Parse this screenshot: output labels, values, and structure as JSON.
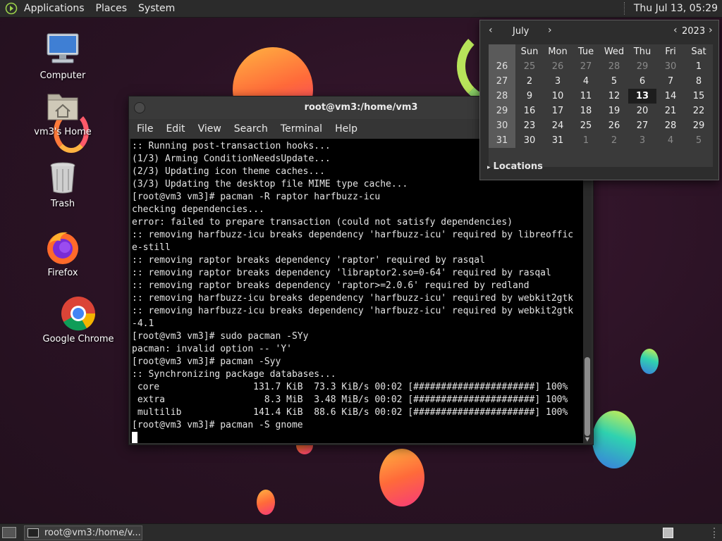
{
  "top_panel": {
    "menus": [
      "Applications",
      "Places",
      "System"
    ],
    "clock": "Thu Jul 13, 05:29"
  },
  "desktop_icons": [
    {
      "label": "Computer",
      "icon": "computer-icon"
    },
    {
      "label": "vm3's Home",
      "icon": "home-folder-icon"
    },
    {
      "label": "Trash",
      "icon": "trash-icon"
    },
    {
      "label": "Firefox",
      "icon": "firefox-icon"
    },
    {
      "label": "Google Chrome",
      "icon": "chrome-icon"
    }
  ],
  "terminal": {
    "title": "root@vm3:/home/vm3",
    "menu": [
      "File",
      "Edit",
      "View",
      "Search",
      "Terminal",
      "Help"
    ],
    "lines": [
      ":: Running post-transaction hooks...",
      "(1/3) Arming ConditionNeedsUpdate...",
      "(2/3) Updating icon theme caches...",
      "(3/3) Updating the desktop file MIME type cache...",
      "[root@vm3 vm3]# pacman -R raptor harfbuzz-icu",
      "checking dependencies...",
      "error: failed to prepare transaction (could not satisfy dependencies)",
      ":: removing harfbuzz-icu breaks dependency 'harfbuzz-icu' required by libreoffic",
      "e-still",
      ":: removing raptor breaks dependency 'raptor' required by rasqal",
      ":: removing raptor breaks dependency 'libraptor2.so=0-64' required by rasqal",
      ":: removing raptor breaks dependency 'raptor>=2.0.6' required by redland",
      ":: removing harfbuzz-icu breaks dependency 'harfbuzz-icu' required by webkit2gtk",
      ":: removing harfbuzz-icu breaks dependency 'harfbuzz-icu' required by webkit2gtk",
      "-4.1",
      "[root@vm3 vm3]# sudo pacman -SYy",
      "pacman: invalid option -- 'Y'",
      "[root@vm3 vm3]# pacman -Syy",
      ":: Synchronizing package databases...",
      " core                 131.7 KiB  73.3 KiB/s 00:02 [######################] 100%",
      " extra                  8.3 MiB  3.48 MiB/s 00:02 [######################] 100%",
      " multilib             141.4 KiB  88.6 KiB/s 00:02 [######################] 100%",
      "[root@vm3 vm3]# pacman -S gnome"
    ]
  },
  "calendar": {
    "month": "July",
    "year": "2023",
    "weekdays": [
      "Sun",
      "Mon",
      "Tue",
      "Wed",
      "Thu",
      "Fri",
      "Sat"
    ],
    "weeks": [
      {
        "wk": "26",
        "days": [
          "25",
          "26",
          "27",
          "28",
          "29",
          "30",
          "1"
        ],
        "dim": [
          0,
          1,
          2,
          3,
          4,
          5
        ]
      },
      {
        "wk": "27",
        "days": [
          "2",
          "3",
          "4",
          "5",
          "6",
          "7",
          "8"
        ],
        "dim": []
      },
      {
        "wk": "28",
        "days": [
          "9",
          "10",
          "11",
          "12",
          "13",
          "14",
          "15"
        ],
        "dim": [],
        "today": 4
      },
      {
        "wk": "29",
        "days": [
          "16",
          "17",
          "18",
          "19",
          "20",
          "21",
          "22"
        ],
        "dim": []
      },
      {
        "wk": "30",
        "days": [
          "23",
          "24",
          "25",
          "26",
          "27",
          "28",
          "29"
        ],
        "dim": []
      },
      {
        "wk": "31",
        "days": [
          "30",
          "31",
          "1",
          "2",
          "3",
          "4",
          "5"
        ],
        "dim": [
          2,
          3,
          4,
          5,
          6
        ]
      }
    ],
    "locations_label": "Locations"
  },
  "bottom_panel": {
    "task_label": "root@vm3:/home/v..."
  }
}
